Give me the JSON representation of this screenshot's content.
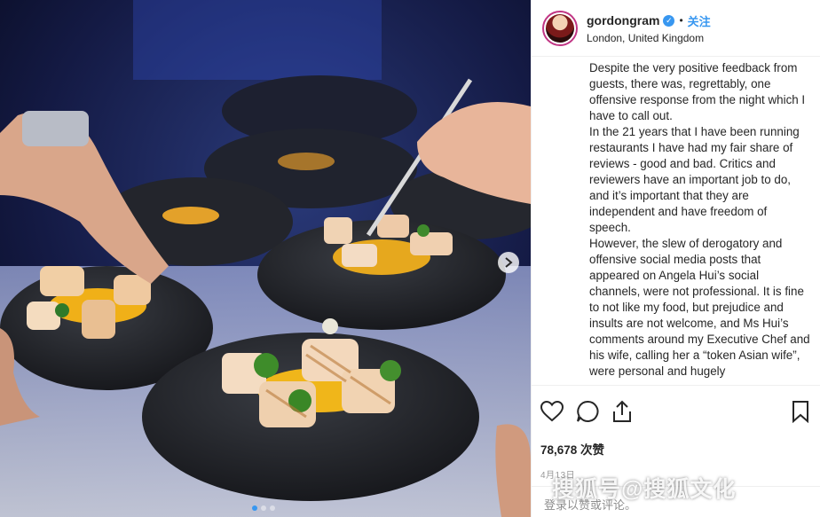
{
  "header": {
    "username": "gordongram",
    "follow_label": "关注",
    "location": "London, United Kingdom",
    "verified": true
  },
  "caption": {
    "paragraphs": [
      "Despite the very positive feedback from guests, there was, regrettably, one offensive response from the night which I have to call out.",
      "In the 21 years that I have been running restaurants I have had my fair share of reviews - good and bad. Critics and reviewers have an important job to do, and it’s important that they are independent and have freedom of speech.",
      "However, the slew of derogatory and offensive social media posts that appeared on Angela Hui’s social channels, were not professional. It is fine to not like my food, but prejudice and insults are not welcome, and Ms Hui’s comments around my Executive Chef and his wife, calling her a “token Asian wife”, were personal and hugely"
    ]
  },
  "actions": {
    "likes": "78,678 次赞",
    "date": "4月13日",
    "login_hint": "登录以赞或评论。"
  },
  "media": {
    "slide_count": 3,
    "current_slide": 1,
    "description_icons": [
      "heart-icon",
      "comment-icon",
      "share-icon",
      "bookmark-icon",
      "chevron-right-icon"
    ]
  },
  "watermark": "搜狐号@搜狐文化",
  "colors": {
    "accent": "#3897f0",
    "text": "#262626",
    "muted": "#8e8e8e"
  }
}
